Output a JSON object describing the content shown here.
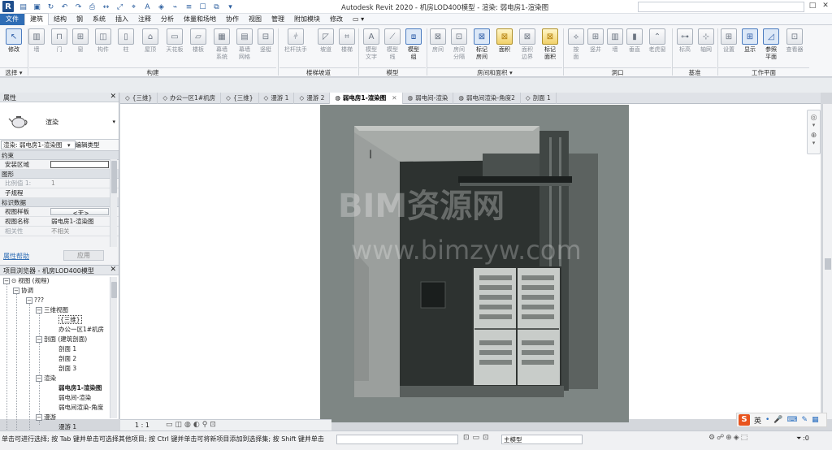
{
  "window": {
    "title": "Autodesk Revit 2020 - 机房LOD400模型 - 渲染: 弱电房1-渲染图",
    "controls": [
      "—",
      "□",
      "✕"
    ]
  },
  "menu": {
    "items": [
      "文件",
      "建筑",
      "结构",
      "钢",
      "系统",
      "插入",
      "注释",
      "分析",
      "体量和场地",
      "协作",
      "视图",
      "管理",
      "附加模块",
      "修改"
    ],
    "extra": "▭ ▾"
  },
  "ribbon": {
    "modify": "修改",
    "select": "选择 ▾",
    "build": [
      "墙",
      "门",
      "窗",
      "构件",
      "柱",
      "屋顶",
      "天花板",
      "楼板",
      "幕墙\n系统",
      "幕墙\n网格",
      "竖梃"
    ],
    "circulation": [
      "栏杆扶手",
      "坡道",
      "楼梯"
    ],
    "model": [
      "模型\n文字",
      "模型\n线",
      "模型\n组"
    ],
    "room": [
      "房间",
      "房间\n分隔",
      "标记\n房间",
      "面积",
      "面积\n边界",
      "标记\n面积"
    ],
    "opening": [
      "按\n面",
      "竖井",
      "墙",
      "垂直",
      "老虎窗"
    ],
    "datum": [
      "标高",
      "轴网"
    ],
    "workplane": [
      "设置",
      "显示",
      "参照\n平面",
      "查看器"
    ],
    "panels": [
      "构建",
      "楼梯坡道",
      "模型",
      "房间和面积 ▾",
      "洞口",
      "基准",
      "工作平面"
    ]
  },
  "properties": {
    "header": "属性",
    "type_name": "渲染",
    "selector": "渲染: 弱电房1-渲染图",
    "edit_type": "编辑类型",
    "groups": [
      "约束",
      "图形",
      "标识数据"
    ],
    "rows": [
      {
        "key": "安装区域",
        "value": ""
      },
      {
        "key": "比例值 1:",
        "value": "1"
      },
      {
        "key": "子规程",
        "value": ""
      },
      {
        "key": "视图样板",
        "value": "<无>"
      },
      {
        "key": "视图名称",
        "value": "弱电房1-渲染图"
      },
      {
        "key": "相关性",
        "value": "不相关"
      }
    ],
    "help": "属性帮助",
    "apply": "应用"
  },
  "browser": {
    "header": "项目浏览器 - 机房LOD400模型",
    "nodes": [
      {
        "text": "视图 (规程)",
        "exp": "−"
      },
      {
        "text": "协调",
        "exp": "−"
      },
      {
        "text": "???",
        "exp": "−"
      },
      {
        "text": "三维视图",
        "exp": "−"
      },
      {
        "text": "{三维}",
        "exp": ""
      },
      {
        "text": "办公一区1#机房",
        "exp": ""
      },
      {
        "text": "剖面 (建筑剖面)",
        "exp": "−"
      },
      {
        "text": "剖面 1",
        "exp": ""
      },
      {
        "text": "剖面 2",
        "exp": ""
      },
      {
        "text": "剖面 3",
        "exp": ""
      },
      {
        "text": "渲染",
        "exp": "−"
      },
      {
        "text": "弱电房1-渲染图",
        "exp": ""
      },
      {
        "text": "弱电间-渲染",
        "exp": ""
      },
      {
        "text": "弱电间渲染-角度",
        "exp": ""
      },
      {
        "text": "漫游",
        "exp": "−"
      },
      {
        "text": "漫游 1",
        "exp": ""
      }
    ]
  },
  "tabs": [
    {
      "label": "{三维}",
      "active": false
    },
    {
      "label": "办公一区1#机房",
      "active": false
    },
    {
      "label": "{三维}",
      "active": false
    },
    {
      "label": "漫游 1",
      "active": false
    },
    {
      "label": "漫游 2",
      "active": false
    },
    {
      "label": "弱电房1-渲染图",
      "active": true
    },
    {
      "label": "弱电间-渲染",
      "active": false
    },
    {
      "label": "弱电间渲染-角度2",
      "active": false
    },
    {
      "label": "剖面 1",
      "active": false
    }
  ],
  "canvas": {
    "watermark_main": "BIM资源网",
    "watermark_url": "www.bimzyw.com"
  },
  "viewbar": {
    "scale": "1 : 1"
  },
  "status": {
    "text": "单击可进行选择; 按 Tab 键并单击可选择其他项目; 按 Ctrl 键并单击可将新项目添加到选择集; 按 Shift 键并单击",
    "model": "主模型",
    "filter": ":0",
    "ime": "英"
  }
}
